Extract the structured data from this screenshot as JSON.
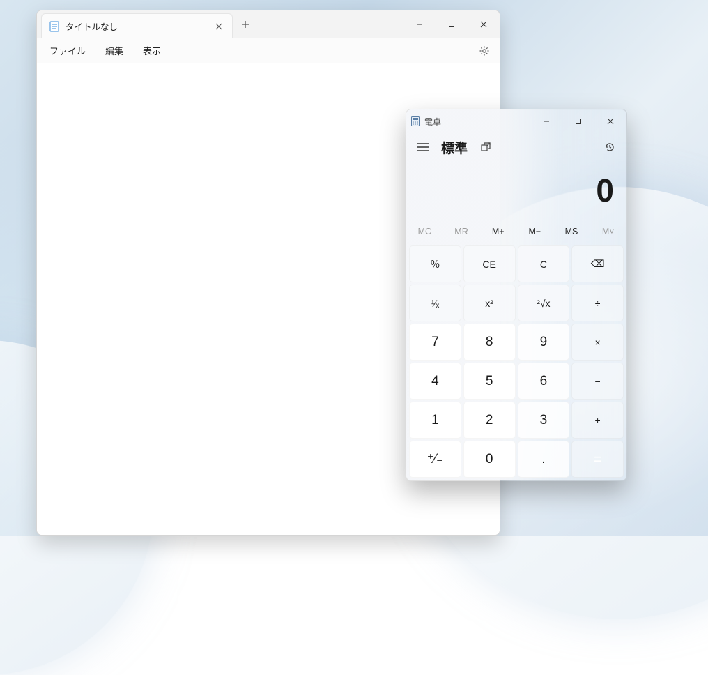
{
  "notepad": {
    "tab_title": "タイトルなし",
    "menu": {
      "file": "ファイル",
      "edit": "編集",
      "view": "表示"
    }
  },
  "calculator": {
    "title": "電卓",
    "mode": "標準",
    "display": "0",
    "memory": {
      "mc": "MC",
      "mr": "MR",
      "mplus": "M+",
      "mminus": "M−",
      "ms": "MS",
      "mlist": "M˅"
    },
    "keys": {
      "percent": "％",
      "ce": "CE",
      "c": "C",
      "backspace": "⌫",
      "recip": "¹⁄ₓ",
      "square": "x²",
      "sqrt": "²√x",
      "divide": "÷",
      "k7": "7",
      "k8": "8",
      "k9": "9",
      "multiply": "×",
      "k4": "4",
      "k5": "5",
      "k6": "6",
      "minus": "−",
      "k1": "1",
      "k2": "2",
      "k3": "3",
      "plus": "+",
      "negate": "⁺⁄₋",
      "k0": "0",
      "decimal": ".",
      "equals": "="
    }
  }
}
